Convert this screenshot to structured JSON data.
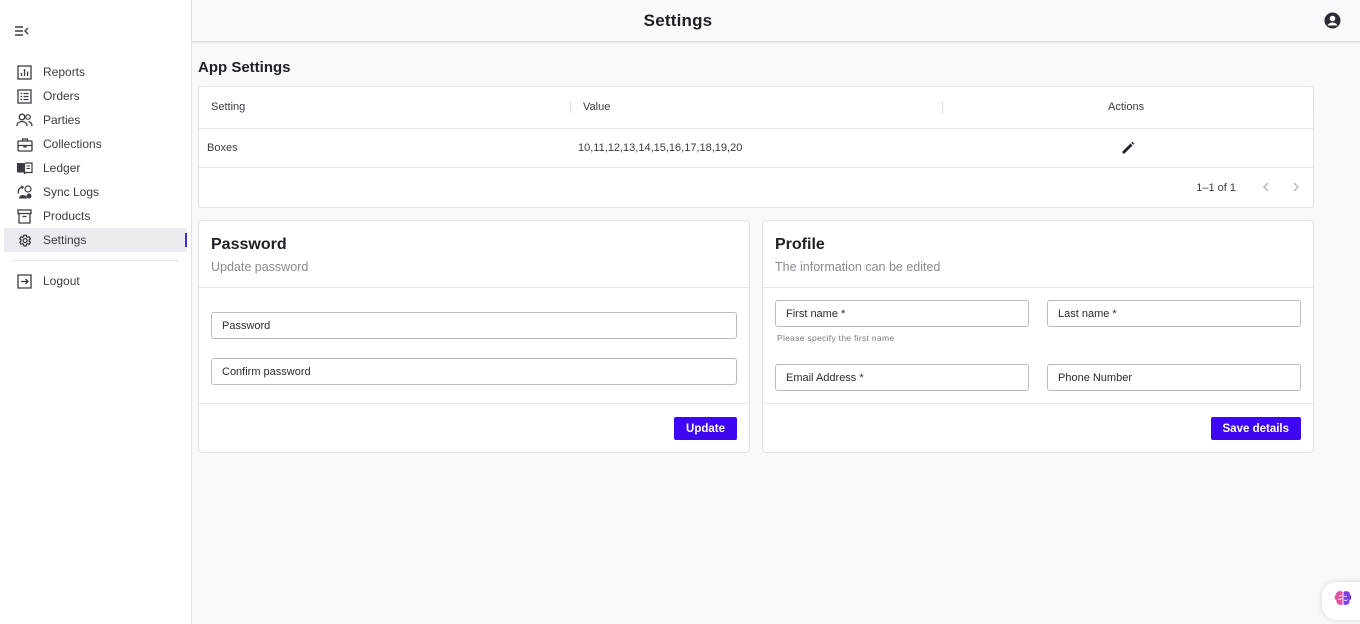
{
  "app": {
    "page_title": "Settings"
  },
  "sidebar": {
    "items": [
      {
        "label": "Reports",
        "icon": "bar-chart-icon"
      },
      {
        "label": "Orders",
        "icon": "list-icon"
      },
      {
        "label": "Parties",
        "icon": "people-icon"
      },
      {
        "label": "Collections",
        "icon": "briefcase-icon"
      },
      {
        "label": "Ledger",
        "icon": "book-icon"
      },
      {
        "label": "Sync Logs",
        "icon": "sync-log-icon"
      },
      {
        "label": "Products",
        "icon": "archive-icon"
      },
      {
        "label": "Settings",
        "icon": "gear-icon",
        "active": true
      }
    ],
    "logout": {
      "label": "Logout",
      "icon": "logout-icon"
    }
  },
  "app_settings": {
    "title": "App Settings",
    "columns": [
      "Setting",
      "Value",
      "Actions"
    ],
    "rows": [
      {
        "setting": "Boxes",
        "value": "10,11,12,13,14,15,16,17,18,19,20"
      }
    ],
    "pagination": "1–1 of 1"
  },
  "password": {
    "title": "Password",
    "subtitle": "Update password",
    "password_label": "Password",
    "confirm_label": "Confirm password",
    "button": "Update"
  },
  "profile": {
    "title": "Profile",
    "subtitle": "The information can be edited",
    "first_name_label": "First name *",
    "first_name_helper": "Please specify the first name",
    "last_name_label": "Last name *",
    "email_label": "Email Address *",
    "phone_label": "Phone Number",
    "button": "Save details"
  },
  "colors": {
    "accent": "#3f06f2",
    "active_indicator": "#3d2ae8"
  }
}
